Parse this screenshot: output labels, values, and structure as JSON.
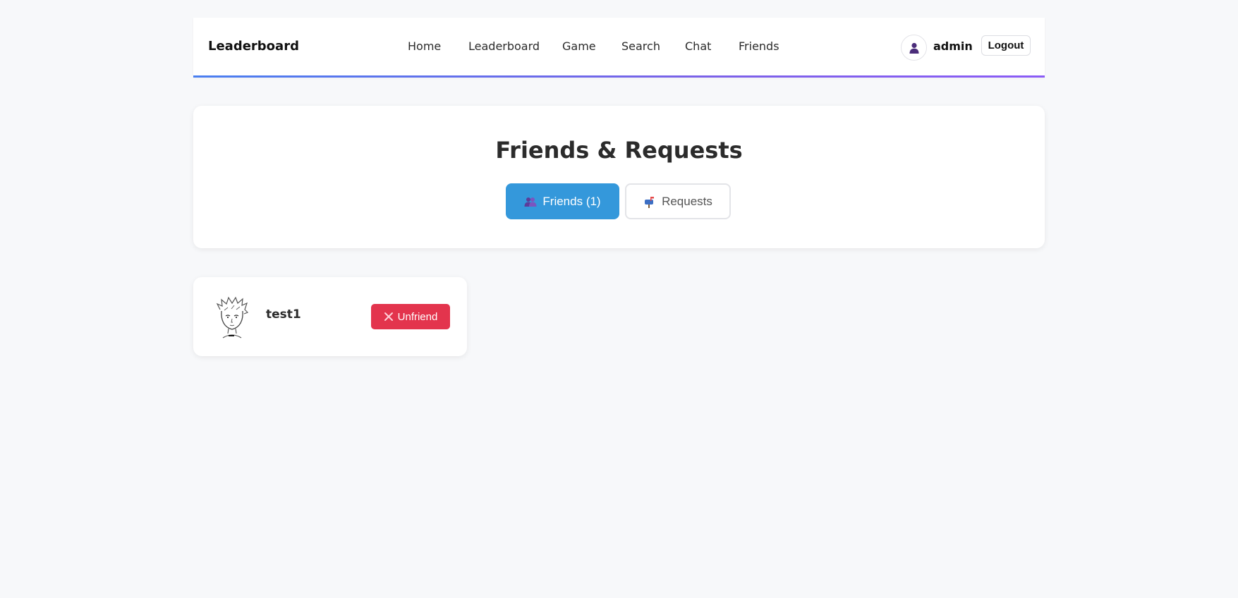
{
  "navbar": {
    "brand": "Leaderboard",
    "links": [
      {
        "label": "Home"
      },
      {
        "label": "Leaderboard"
      },
      {
        "label": "Game"
      },
      {
        "label": "Search"
      },
      {
        "label": "Chat"
      },
      {
        "label": "Friends"
      }
    ],
    "user": {
      "name": "admin",
      "avatar_icon": "user-silhouette-icon"
    },
    "logout_label": "Logout",
    "accent_gradient": [
      "#4a7ff0",
      "#8b5cf6"
    ]
  },
  "page": {
    "title": "Friends & Requests",
    "tabs": [
      {
        "label": "Friends (1)",
        "icon": "people-icon",
        "active": true
      },
      {
        "label": "Requests",
        "icon": "mailbox-icon",
        "active": false
      }
    ]
  },
  "friends": [
    {
      "name": "test1",
      "avatar": "sketch-portrait-avatar",
      "action_label": "Unfriend",
      "action_icon": "x-icon"
    }
  ],
  "colors": {
    "background": "#f7f8fa",
    "active_tab": "#3498db",
    "danger": "#e3344d"
  }
}
